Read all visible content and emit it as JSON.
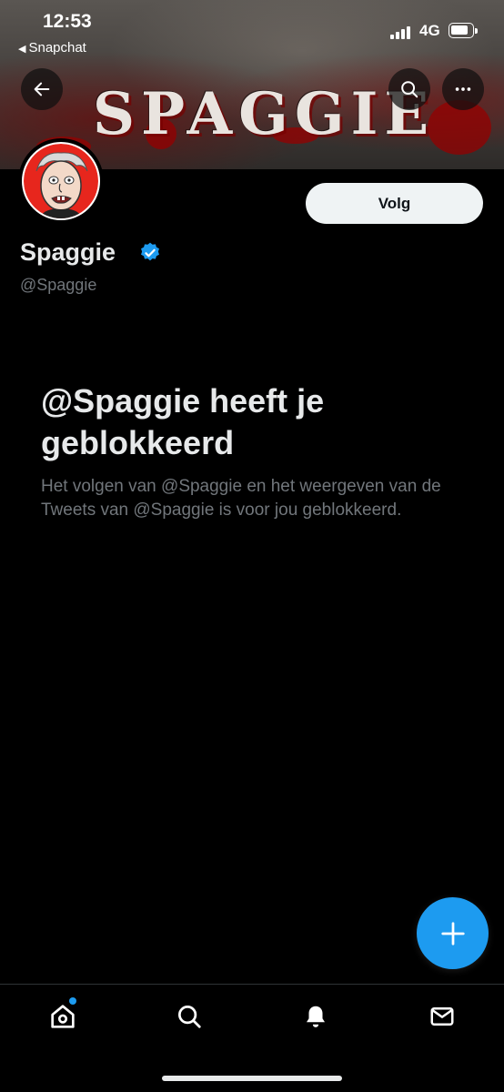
{
  "status_bar": {
    "time": "12:53",
    "back_app": "Snapchat",
    "network": "4G"
  },
  "banner": {
    "title": "SPAGGIE"
  },
  "header": {
    "back_icon": "arrow-left-icon",
    "search_icon": "search-icon",
    "more_icon": "more-horizontal-icon"
  },
  "profile": {
    "display_name": "Spaggie",
    "handle": "@Spaggie",
    "verified_icon": "verified-badge-icon",
    "follow_label": "Volg"
  },
  "blocked": {
    "title": "@Spaggie heeft je geblokkeerd",
    "message": "Het volgen van @Spaggie en het weergeven van de Tweets van @Spaggie is voor jou geblokkeerd."
  },
  "fab": {
    "icon": "plus-icon"
  },
  "tabbar": {
    "items": [
      {
        "name": "home",
        "icon": "home-icon",
        "has_notification_dot": true
      },
      {
        "name": "search",
        "icon": "search-icon"
      },
      {
        "name": "notifications",
        "icon": "bell-icon"
      },
      {
        "name": "messages",
        "icon": "mail-icon"
      }
    ]
  },
  "colors": {
    "accent": "#1d9bf0",
    "background": "#000000",
    "primary_text": "#e7e9ea",
    "secondary_text": "#71767b",
    "follow_button_bg": "#eff3f4"
  }
}
